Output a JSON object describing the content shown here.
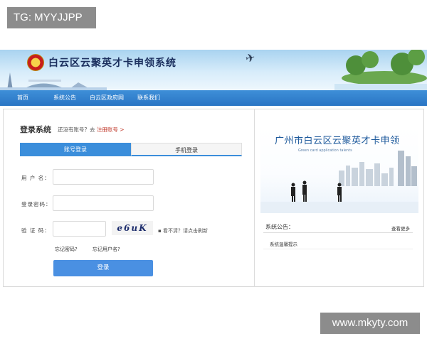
{
  "watermarks": {
    "top_left": "TG: MYYJJPP",
    "bottom_right": "www.mkyty.com"
  },
  "header": {
    "site_title": "白云区云聚英才卡申领系统"
  },
  "nav": {
    "items": [
      "首页",
      "系统公告",
      "白云区政府网",
      "联系我们"
    ]
  },
  "login": {
    "title": "登录系统",
    "register_prompt": "还没有账号？去",
    "register_link": "注册账号 >",
    "tabs": [
      "账号登录",
      "手机登录"
    ],
    "username_label": "用 户 名：",
    "password_label": "登录密码：",
    "captcha_label": "验 证 码：",
    "captcha_text": "e6uK",
    "refresh_hint": "看不清？请点击刷新",
    "forgot_password": "忘记密码?",
    "forgot_username": "忘记用户名?",
    "submit": "登录"
  },
  "promo": {
    "title": "广州市白云区云聚英才卡申领",
    "subtitle": "Green card application talents"
  },
  "notice": {
    "heading": "系统公告：",
    "more": "查看更多",
    "items": [
      "系统温馨提示"
    ]
  },
  "colors": {
    "nav_bg": "#2a75c4",
    "accent": "#3b8edb",
    "button": "#4a90e2",
    "link_red": "#c0392b"
  }
}
